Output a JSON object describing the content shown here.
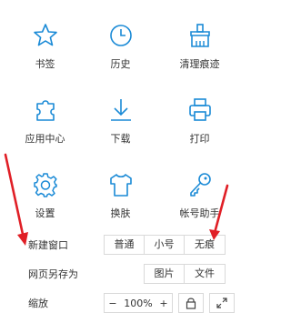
{
  "grid": [
    {
      "label": "书签",
      "icon": "star-icon"
    },
    {
      "label": "历史",
      "icon": "clock-icon"
    },
    {
      "label": "清理痕迹",
      "icon": "brush-icon"
    },
    {
      "label": "应用中心",
      "icon": "puzzle-icon"
    },
    {
      "label": "下载",
      "icon": "download-icon"
    },
    {
      "label": "打印",
      "icon": "printer-icon"
    },
    {
      "label": "设置",
      "icon": "gear-icon"
    },
    {
      "label": "换肤",
      "icon": "shirt-icon"
    },
    {
      "label": "帐号助手",
      "icon": "key-icon"
    }
  ],
  "new_window": {
    "label": "新建窗口",
    "options": [
      "普通",
      "小号",
      "无痕"
    ]
  },
  "save_as": {
    "label": "网页另存为",
    "options": [
      "图片",
      "文件"
    ]
  },
  "zoom": {
    "label": "缩放",
    "minus": "−",
    "value": "100%",
    "plus": "+"
  },
  "colors": {
    "icon_blue": "#1a8ad6",
    "arrow_red": "#e01f26"
  }
}
